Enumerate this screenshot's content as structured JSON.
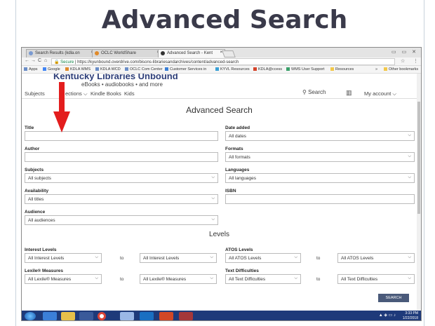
{
  "slide": {
    "title": "Advanced Search"
  },
  "browser": {
    "tabs": [
      {
        "label": "Search Results (kdla.on",
        "close": "×"
      },
      {
        "label": "OCLC WorldShare",
        "close": "×"
      },
      {
        "label": "Advanced Search - Kent",
        "close": "×"
      }
    ],
    "window_controls": "▭ ▭ ✕",
    "nav_icons": {
      "back": "←",
      "forward": "→",
      "reload": "C",
      "home": "⌂"
    },
    "address": {
      "secure_label": "Secure",
      "url": "https://kyunbound.overdrive.com/bisons-librariesandarchives/content/advanced-search"
    },
    "bookmarks": [
      "Apps",
      "Google",
      "KDLA WMS",
      "KDLA WCD",
      "OCLC Com Center",
      "Customer Services in",
      "KYVL Resources",
      "KDLA@ccess",
      "WMS User Support",
      "Resources",
      "»",
      "Other bookmarks"
    ]
  },
  "site": {
    "library_name": "Kentucky Libraries Unbound",
    "tagline": "eBooks • audiobooks • and more",
    "nav": {
      "subjects": "Subjects",
      "collections": "ections ⌵",
      "kindle": "Kindle Books",
      "kids": "Kids",
      "search": "Search",
      "account": "My account ⌵"
    }
  },
  "form": {
    "heading": "Advanced Search",
    "title": {
      "label": "Title",
      "value": ""
    },
    "date_added": {
      "label": "Date added",
      "value": "All dates"
    },
    "author": {
      "label": "Author",
      "value": ""
    },
    "formats": {
      "label": "Formats",
      "value": "All formats"
    },
    "subjects": {
      "label": "Subjects",
      "value": "All subjects"
    },
    "languages": {
      "label": "Languages",
      "value": "All languages"
    },
    "availability": {
      "label": "Availability",
      "value": "All titles"
    },
    "isbn": {
      "label": "ISBN",
      "value": ""
    },
    "audience": {
      "label": "Audience",
      "value": "All audiences"
    },
    "levels_heading": "Levels",
    "interest": {
      "label": "Interest Levels",
      "from": "All Interest Levels",
      "to": "All Interest Levels"
    },
    "atos": {
      "label": "ATOS Levels",
      "from": "All ATOS Levels",
      "to": "All ATOS Levels"
    },
    "lexile": {
      "label": "Lexile® Measures",
      "from": "All Lexile® Measures",
      "to": "All Lexile® Measures"
    },
    "text_difficulties": {
      "label": "Text Difficulties",
      "from": "All Text Difficulties",
      "to": "All Text Difficulties"
    },
    "to_word": "to",
    "search_button": "SEARCH"
  },
  "taskbar": {
    "clock_time": "3:33 PM",
    "clock_date": "1/22/2018"
  },
  "colors": {
    "arrow": "#e31d1d",
    "library_blue": "#2e3f79",
    "taskbar": "#1e3a7a"
  }
}
